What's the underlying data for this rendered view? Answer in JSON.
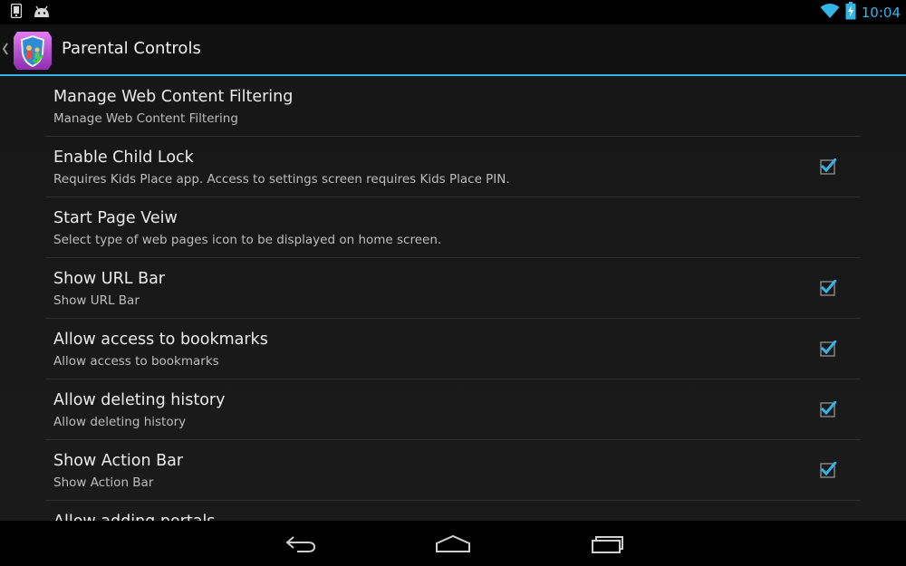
{
  "status_bar": {
    "time": "10:04",
    "icons": [
      "device-icon",
      "android-icon",
      "wifi-icon",
      "battery-charging-icon"
    ]
  },
  "action_bar": {
    "title": "Parental Controls",
    "icons": [
      "up-caret-icon",
      "app-shield-icon"
    ]
  },
  "accent_color": "#33b5e5",
  "preferences": [
    {
      "title": "Manage Web Content Filtering",
      "summary": "Manage Web Content Filtering",
      "checkbox": false
    },
    {
      "title": "Enable Child Lock",
      "summary": "Requires Kids Place app. Access to settings screen requires Kids Place PIN.",
      "checkbox": true,
      "checked": true
    },
    {
      "title": "Start Page Veiw",
      "summary": "Select type of web pages icon to be displayed on home screen.",
      "checkbox": false
    },
    {
      "title": "Show URL Bar",
      "summary": "Show URL Bar",
      "checkbox": true,
      "checked": true
    },
    {
      "title": "Allow access to bookmarks",
      "summary": "Allow access to bookmarks",
      "checkbox": true,
      "checked": true
    },
    {
      "title": "Allow deleting history",
      "summary": "Allow deleting history",
      "checkbox": true,
      "checked": true
    },
    {
      "title": "Show Action Bar",
      "summary": "Show Action Bar",
      "checkbox": true,
      "checked": true
    },
    {
      "title": "Allow adding portals",
      "summary": "",
      "checkbox": false
    }
  ],
  "nav_bar": {
    "buttons": [
      "back-icon",
      "home-icon",
      "recent-apps-icon"
    ]
  }
}
